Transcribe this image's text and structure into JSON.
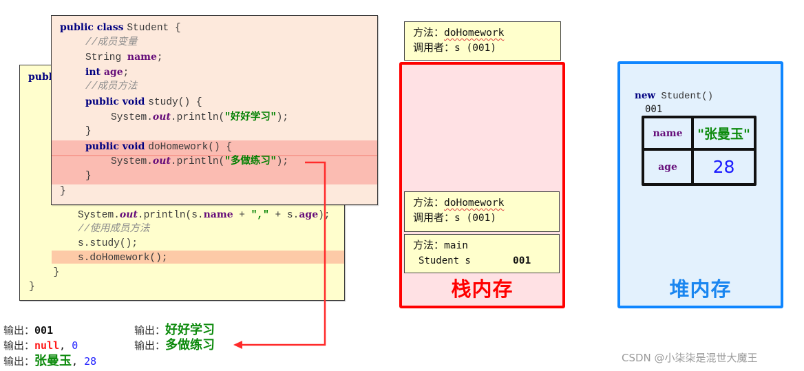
{
  "colors": {
    "stack_accent": "#ff0000",
    "heap_accent": "#0f86ff",
    "arrow": "#ff2b2b",
    "keyword": "#000080",
    "field": "#660e7a",
    "string": "#008000",
    "comment": "#8c8c8c"
  },
  "back_code": {
    "header_visible": "publ",
    "lines": [
      {
        "indent": 2,
        "tokens": [
          [
            "plain",
            "System."
          ],
          [
            "static",
            "out"
          ],
          [
            "plain",
            ".println(s."
          ],
          [
            "field",
            "name"
          ],
          [
            "plain",
            " + "
          ],
          [
            "str",
            "\",\""
          ],
          [
            "plain",
            " + s."
          ],
          [
            "field",
            "age"
          ],
          [
            "plain",
            ");"
          ]
        ]
      },
      {
        "indent": 2,
        "tokens": [
          [
            "comment",
            "//使用成员方法"
          ]
        ]
      },
      {
        "indent": 2,
        "tokens": [
          [
            "plain",
            "s.study();"
          ]
        ]
      },
      {
        "indent": 2,
        "tokens": [
          [
            "plain",
            "s.doHomework();"
          ]
        ],
        "highlight": true
      },
      {
        "indent": 1,
        "tokens": [
          [
            "plain",
            "}"
          ]
        ]
      },
      {
        "indent": 0,
        "tokens": [
          [
            "plain",
            "}"
          ]
        ]
      }
    ]
  },
  "front_code": {
    "lines": [
      {
        "indent": 0,
        "tokens": [
          [
            "kw",
            "public class "
          ],
          [
            "plain",
            "Student {"
          ]
        ]
      },
      {
        "indent": 1,
        "tokens": [
          [
            "comment",
            "//成员变量"
          ]
        ]
      },
      {
        "indent": 1,
        "tokens": [
          [
            "plain",
            "String "
          ],
          [
            "field",
            "name"
          ],
          [
            "plain",
            ";"
          ]
        ]
      },
      {
        "indent": 1,
        "tokens": [
          [
            "kw",
            "int "
          ],
          [
            "field",
            "age"
          ],
          [
            "plain",
            ";"
          ]
        ]
      },
      {
        "indent": 1,
        "tokens": [
          [
            "comment",
            "//成员方法"
          ]
        ]
      },
      {
        "indent": 1,
        "tokens": [
          [
            "kw",
            "public void "
          ],
          [
            "plain",
            "study() {"
          ]
        ]
      },
      {
        "indent": 2,
        "tokens": [
          [
            "plain",
            "System."
          ],
          [
            "static",
            "out"
          ],
          [
            "plain",
            ".println("
          ],
          [
            "str",
            "\"好好学习\""
          ],
          [
            "plain",
            ");"
          ]
        ]
      },
      {
        "indent": 1,
        "tokens": [
          [
            "plain",
            "}"
          ]
        ]
      },
      {
        "indent": 1,
        "tokens": [
          [
            "kw",
            "public void "
          ],
          [
            "plain",
            "doHomework() {"
          ]
        ],
        "highlight": true
      },
      {
        "indent": 2,
        "tokens": [
          [
            "plain",
            "System."
          ],
          [
            "static",
            "out"
          ],
          [
            "plain",
            ".println("
          ],
          [
            "str",
            "\"多做练习\""
          ],
          [
            "plain",
            ");"
          ]
        ],
        "highlight": true
      },
      {
        "indent": 1,
        "tokens": [
          [
            "plain",
            "}"
          ]
        ],
        "highlight": true
      },
      {
        "indent": 0,
        "tokens": [
          [
            "plain",
            "}"
          ]
        ]
      }
    ]
  },
  "outputs": {
    "left": [
      {
        "label": "输出：",
        "parts": [
          [
            "bold",
            "001"
          ]
        ]
      },
      {
        "label": "输出：",
        "parts": [
          [
            "red",
            "null"
          ],
          [
            "plain",
            ", "
          ],
          [
            "blue",
            "0"
          ]
        ]
      },
      {
        "label": "输出：",
        "parts": [
          [
            "green",
            "张曼玉"
          ],
          [
            "plain",
            ", "
          ],
          [
            "blue",
            "28"
          ]
        ]
      }
    ],
    "right": [
      {
        "label": "输出：",
        "value": "好好学习"
      },
      {
        "label": "输出：",
        "value": "多做练习"
      }
    ]
  },
  "stack": {
    "label": "栈内存",
    "floating_frame": {
      "method_label": "方法：",
      "method": "doHomework",
      "caller_label": "调用者：",
      "caller": "s (001)"
    },
    "frames": [
      {
        "method_label": "方法：",
        "method": "doHomework",
        "caller_label": "调用者：",
        "caller": "s (001)"
      },
      {
        "method_label": "方法：",
        "method": "main",
        "var": "Student s",
        "value": "001"
      }
    ]
  },
  "heap": {
    "label": "堆内存",
    "new_keyword": "new",
    "constructor": " Student()",
    "address": "001",
    "fields": [
      {
        "name": "name",
        "value": "\"张曼玉\""
      },
      {
        "name": "age",
        "value": "28"
      }
    ]
  },
  "watermark": "CSDN @小柒柒是混世大魔王"
}
